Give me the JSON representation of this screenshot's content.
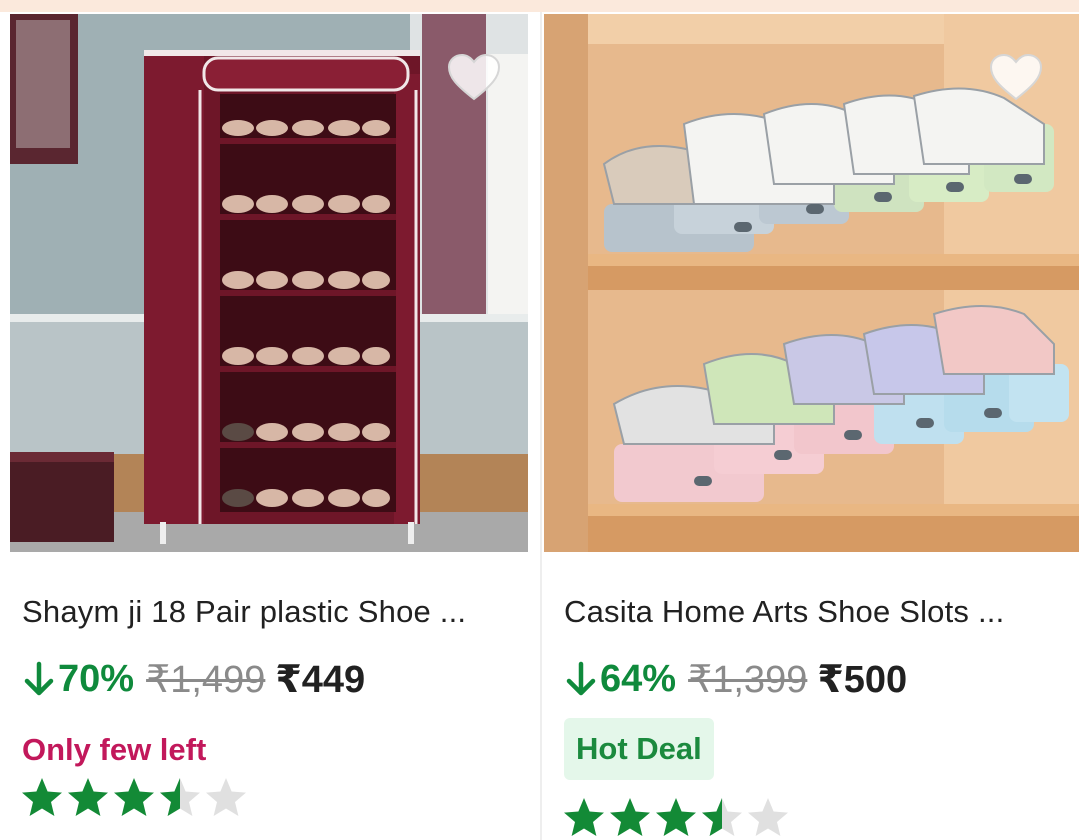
{
  "colors": {
    "discount_green": "#0f8a3c",
    "few_left_pink": "#c2185b",
    "hot_deal_bg": "#e4f7ea",
    "hot_deal_text": "#1b8a3e",
    "star_filled": "#138a36",
    "star_empty": "#e0e0e0"
  },
  "products": [
    {
      "title": "Shaym ji 18 Pair plastic Shoe ...",
      "discount": "70%",
      "mrp": "₹1,499",
      "price": "₹449",
      "badge": "Only few left",
      "rating": 3.5,
      "wishlist_icon": "heart-outline-icon",
      "image": "maroon fabric shoe rack with shoes"
    },
    {
      "title": "Casita Home Arts Shoe Slots ...",
      "discount": "64%",
      "mrp": "₹1,399",
      "price": "₹500",
      "badge": "Hot Deal",
      "rating": 3.5,
      "wishlist_icon": "heart-outline-icon",
      "image": "pastel plastic shoe slot organizers on wooden shelf"
    }
  ]
}
